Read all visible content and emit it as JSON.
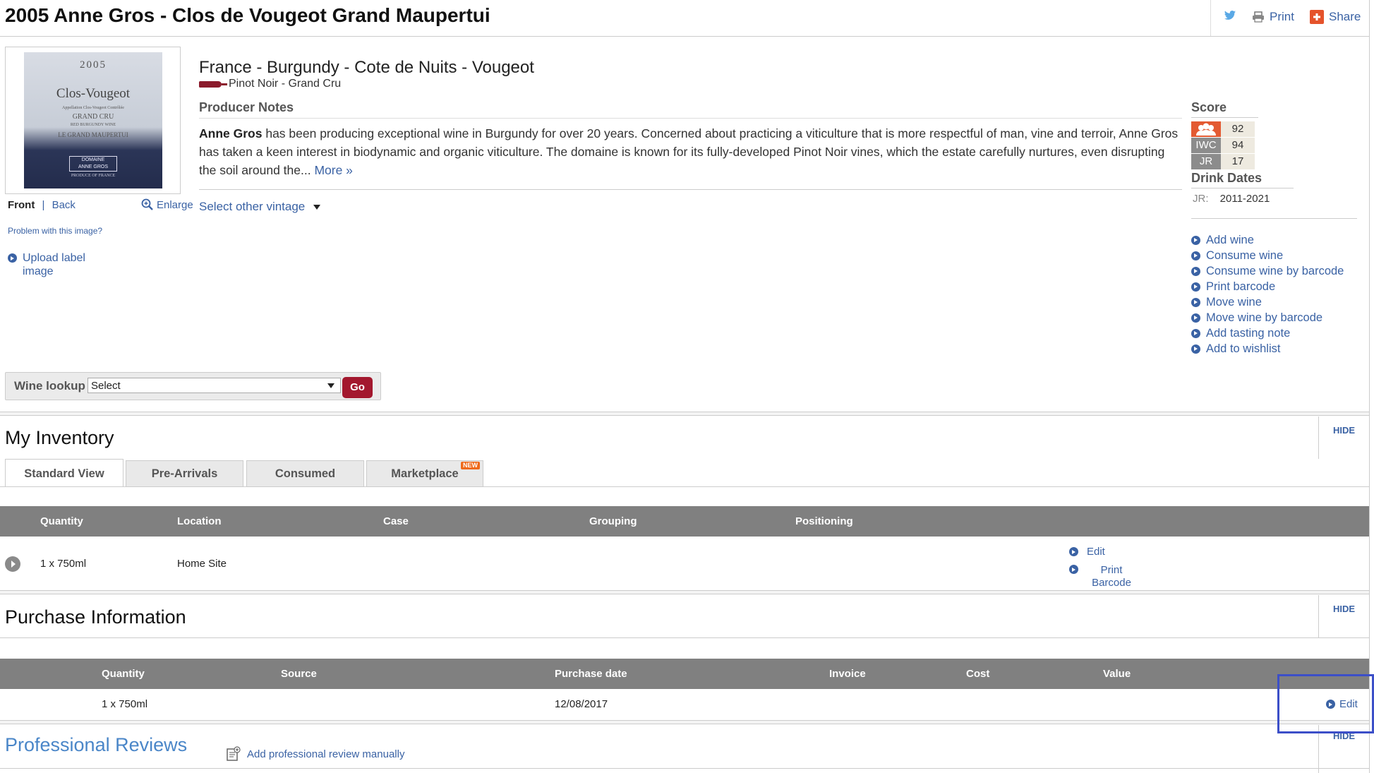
{
  "header": {
    "title": "2005 Anne Gros - Clos de Vougeot Grand Maupertui",
    "print_label": "Print",
    "share_label": "Share"
  },
  "label_image": {
    "vintage": "2005",
    "name": "Clos-Vougeot",
    "appellation": "Appellation Clos-Vougeot Contrôlée",
    "grade": "GRAND CRU",
    "kind": "RED BURGUNDY WINE",
    "vineyard": "LE GRAND MAUPERTUI",
    "domaine_line1": "DOMAINE",
    "domaine_line2": "ANNE GROS",
    "origin": "PRODUCE OF FRANCE",
    "front_label": "Front",
    "separator": "|",
    "back_label": "Back",
    "enlarge_label": "Enlarge",
    "problem_label": "Problem with this image?",
    "upload_label": "Upload label image"
  },
  "wine": {
    "region": "France - Burgundy - Cote de Nuits - Vougeot",
    "varietal": "Pinot Noir - Grand Cru",
    "producer_notes_heading": "Producer Notes",
    "producer_name": "Anne Gros",
    "producer_notes_text": " has been producing exceptional wine in Burgundy for over 20 years. Concerned about practicing a viticulture that is more respectful of man, vine and terroir, Anne Gros has taken a keen interest in biodynamic and organic viticulture. The domaine is known for its fully-developed Pinot Noir vines, which the estate carefully nurtures, even disrupting the soil around the... ",
    "more_link": "More »",
    "select_vintage": "Select other vintage"
  },
  "score": {
    "heading": "Score",
    "rows": [
      {
        "label": "",
        "value": "92"
      },
      {
        "label": "IWC",
        "value": "94"
      },
      {
        "label": "JR",
        "value": "17"
      }
    ]
  },
  "drink_dates": {
    "heading": "Drink Dates",
    "source": "JR:",
    "range": "2011-2021"
  },
  "actions": [
    "Add wine",
    "Consume wine",
    "Consume wine by barcode",
    "Print barcode",
    "Move wine",
    "Move wine by barcode",
    "Add tasting note",
    "Add to wishlist"
  ],
  "lookup": {
    "label": "Wine lookup",
    "selected": "Select",
    "go_label": "Go"
  },
  "inventory": {
    "title": "My Inventory",
    "hide_label": "HIDE",
    "tabs": [
      "Standard View",
      "Pre-Arrivals",
      "Consumed",
      "Marketplace"
    ],
    "new_badge": "NEW",
    "columns": [
      "Quantity",
      "Location",
      "Case",
      "Grouping",
      "Positioning"
    ],
    "row": {
      "quantity": "1 x 750ml",
      "location": "Home Site",
      "edit_label": "Edit",
      "print_label": "Print",
      "barcode_label": "Barcode"
    }
  },
  "purchase": {
    "title": "Purchase Information",
    "hide_label": "HIDE",
    "columns": [
      "Quantity",
      "Source",
      "Purchase date",
      "Invoice",
      "Cost",
      "Value"
    ],
    "row": {
      "quantity": "1 x 750ml",
      "purchase_date": "12/08/2017",
      "edit_label": "Edit"
    }
  },
  "reviews": {
    "title": "Professional Reviews",
    "add_label": "Add professional review manually",
    "hide_label": "HIDE"
  },
  "colors": {
    "link": "#3a62a4",
    "brand_red": "#a3182e",
    "table_header": "#808080",
    "highlight": "#3c4fc8"
  }
}
